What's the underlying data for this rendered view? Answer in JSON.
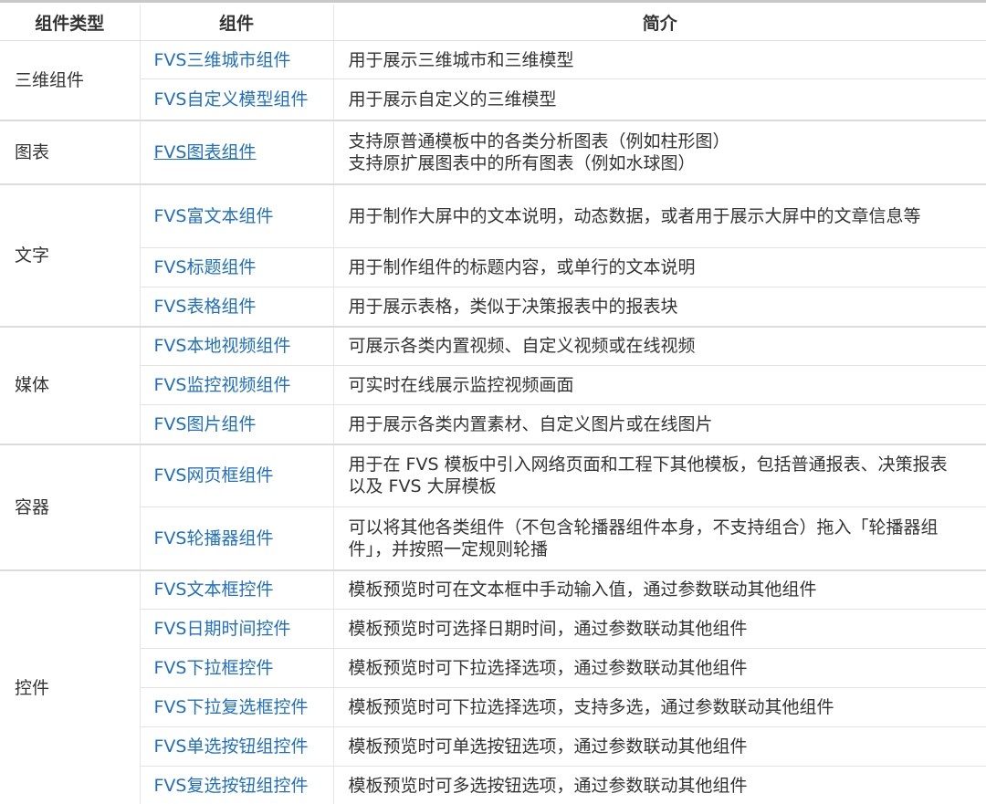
{
  "headers": [
    "组件类型",
    "组件",
    "简介"
  ],
  "groups": [
    {
      "type": "三维组件",
      "rows": [
        {
          "component": "FVS三维城市组件",
          "desc": "用于展示三维城市和三维模型",
          "height": 42
        },
        {
          "component": "FVS自定义模型组件",
          "desc": "用于展示自定义的三维模型",
          "height": 45
        }
      ]
    },
    {
      "type": "图表",
      "rows": [
        {
          "component": "FVS图表组件",
          "desc": "支持原普通模板中的各类分析图表（例如柱形图）\n支持原扩展图表中的所有图表（例如水球图）",
          "height": 70,
          "underline": true
        }
      ]
    },
    {
      "type": "文字",
      "rows": [
        {
          "component": "FVS富文本组件",
          "desc": "用于制作大屏中的文本说明，动态数据，或者用于展示大屏中的文章信息等",
          "height": 70
        },
        {
          "component": "FVS标题组件",
          "desc": "用于制作组件的标题内容，或单行的文本说明",
          "height": 43
        },
        {
          "component": "FVS表格组件",
          "desc": "用于展示表格，类似于决策报表中的报表块",
          "height": 43
        }
      ]
    },
    {
      "type": "媒体",
      "rows": [
        {
          "component": "FVS本地视频组件",
          "desc": "可展示各类内置视频、自定义视频或在线视频",
          "height": 43
        },
        {
          "component": "FVS监控视频组件",
          "desc": "可实时在线展示监控视频画面",
          "height": 43
        },
        {
          "component": "FVS图片组件",
          "desc": "用于展示各类内置素材、自定义图片或在线图片",
          "height": 43
        }
      ]
    },
    {
      "type": "容器",
      "rows": [
        {
          "component": "FVS网页框组件",
          "desc": "用于在 FVS 模板中引入网络页面和工程下其他模板，包括普通报表、决策报表以及 FVS 大屏模板",
          "height": 69
        },
        {
          "component": "FVS轮播器组件",
          "desc": "可以将其他各类组件（不包含轮播器组件本身，不支持组合）拖入「轮播器组件」，并按照一定规则轮播",
          "height": 69
        }
      ]
    },
    {
      "type": "控件",
      "rows": [
        {
          "component": "FVS文本框控件",
          "desc": "模板预览时可在文本框中手动输入值，通过参数联动其他组件",
          "height": 43
        },
        {
          "component": "FVS日期时间控件",
          "desc": "模板预览时可选择日期时间，通过参数联动其他组件",
          "height": 43
        },
        {
          "component": "FVS下拉框控件",
          "desc": "模板预览时可下拉选择选项，通过参数联动其他组件",
          "height": 43
        },
        {
          "component": "FVS下拉复选框控件",
          "desc": "模板预览时可下拉选择选项，支持多选，通过参数联动其他组件",
          "height": 43
        },
        {
          "component": "FVS单选按钮组控件",
          "desc": "模板预览时可单选按钮选项，通过参数联动其他组件",
          "height": 43
        },
        {
          "component": "FVS复选按钮组控件",
          "desc": "模板预览时可多选按钮选项，通过参数联动其他组件",
          "height": 43
        }
      ]
    }
  ],
  "colors": {
    "link": "#1f6fc4",
    "text": "#333333",
    "border": "#e3e3e3"
  }
}
